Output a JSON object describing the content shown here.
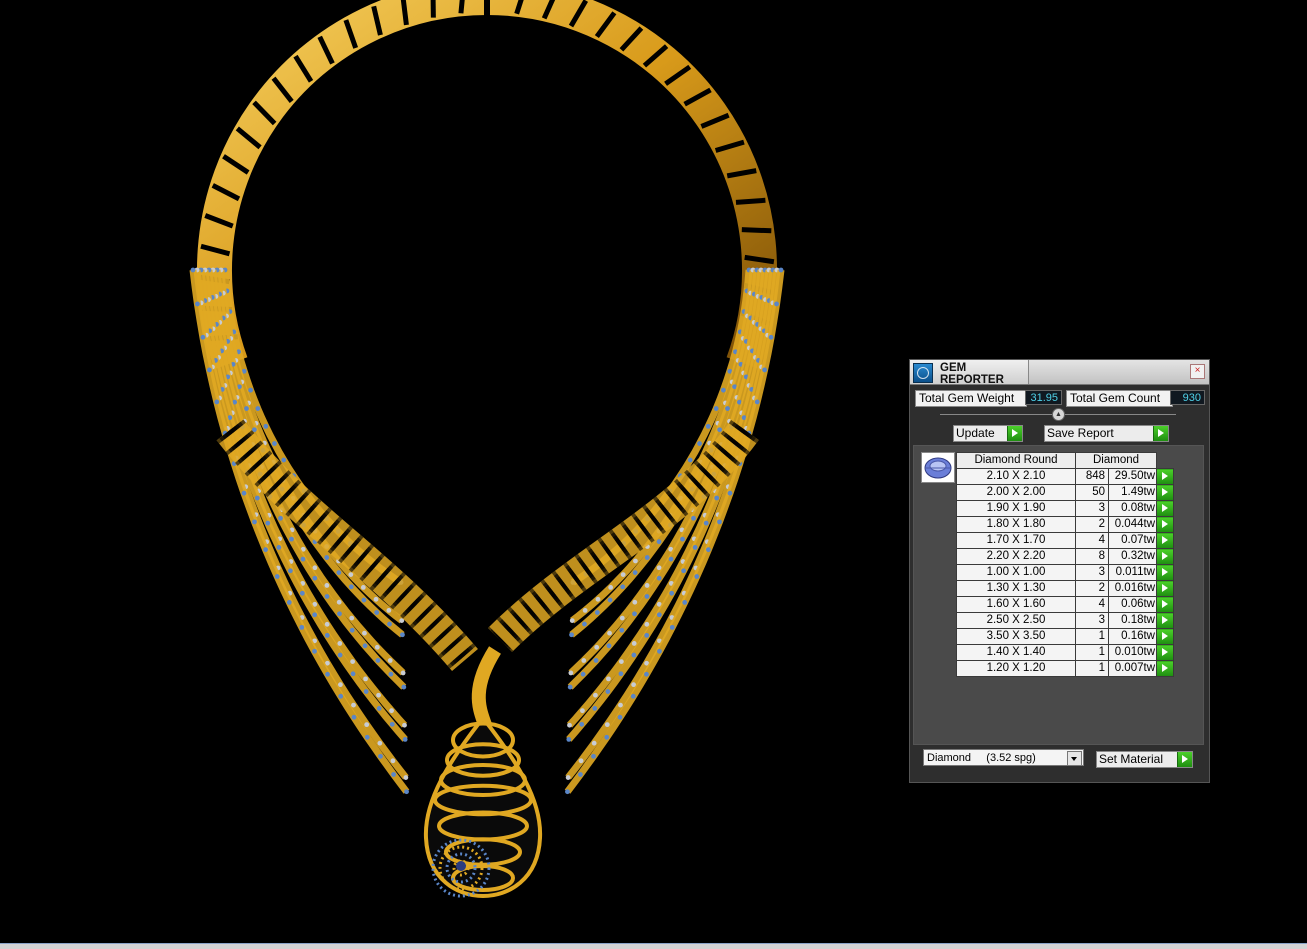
{
  "panel": {
    "title": "GEM REPORTER",
    "close_glyph": "×",
    "total_weight_label": "Total Gem Weight",
    "total_weight_value": "31.95",
    "total_count_label": "Total Gem Count",
    "total_count_value": "930",
    "collapse_glyph": "▲",
    "update_label": "Update",
    "save_report_label": "Save Report",
    "table": {
      "header_shape": "Diamond Round",
      "header_material": "Diamond",
      "rows": [
        {
          "size": "2.10 X 2.10",
          "count": "848",
          "weight": "29.50tw"
        },
        {
          "size": "2.00 X 2.00",
          "count": "50",
          "weight": "1.49tw"
        },
        {
          "size": "1.90 X 1.90",
          "count": "3",
          "weight": "0.08tw"
        },
        {
          "size": "1.80 X 1.80",
          "count": "2",
          "weight": "0.044tw"
        },
        {
          "size": "1.70 X 1.70",
          "count": "4",
          "weight": "0.07tw"
        },
        {
          "size": "2.20 X 2.20",
          "count": "8",
          "weight": "0.32tw"
        },
        {
          "size": "1.00 X 1.00",
          "count": "3",
          "weight": "0.011tw"
        },
        {
          "size": "1.30 X 1.30",
          "count": "2",
          "weight": "0.016tw"
        },
        {
          "size": "1.60 X 1.60",
          "count": "4",
          "weight": "0.06tw"
        },
        {
          "size": "2.50 X 2.50",
          "count": "3",
          "weight": "0.18tw"
        },
        {
          "size": "3.50 X 3.50",
          "count": "1",
          "weight": "0.16tw"
        },
        {
          "size": "1.40 X 1.40",
          "count": "1",
          "weight": "0.010tw"
        },
        {
          "size": "1.20 X 1.20",
          "count": "1",
          "weight": "0.007tw"
        }
      ]
    },
    "material_selected": "Diamond     (3.52 spg)",
    "set_material_label": "Set Material"
  },
  "colors": {
    "gold": "#e0a822",
    "gold_dark": "#8a5a08",
    "gem_blue": "#5a86c8",
    "gem_silver": "#c8ccd4",
    "accent_cyan": "#4fd1e8",
    "go_green": "#2ea81a"
  }
}
